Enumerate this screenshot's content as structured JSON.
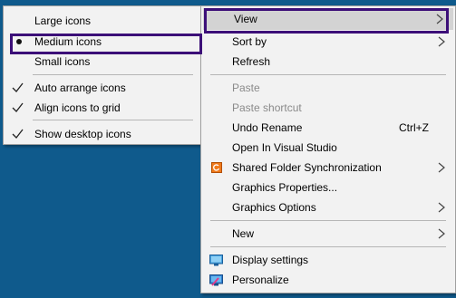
{
  "submenu": {
    "items": [
      {
        "label": "Large icons"
      },
      {
        "label": "Medium icons",
        "selected": true
      },
      {
        "label": "Small icons"
      },
      {
        "label": "Auto arrange icons",
        "checked": true
      },
      {
        "label": "Align icons to grid",
        "checked": true
      },
      {
        "label": "Show desktop icons",
        "checked": true
      }
    ]
  },
  "context_menu": {
    "items": [
      {
        "label": "View",
        "submenu": true,
        "highlighted": true
      },
      {
        "label": "Sort by",
        "submenu": true
      },
      {
        "label": "Refresh"
      },
      {
        "label": "Paste",
        "disabled": true
      },
      {
        "label": "Paste shortcut",
        "disabled": true
      },
      {
        "label": "Undo Rename",
        "shortcut": "Ctrl+Z"
      },
      {
        "label": "Open In Visual Studio"
      },
      {
        "label": "Shared Folder Synchronization",
        "submenu": true,
        "icon": "shared-folder-sync-icon"
      },
      {
        "label": "Graphics Properties..."
      },
      {
        "label": "Graphics Options",
        "submenu": true
      },
      {
        "label": "New",
        "submenu": true
      },
      {
        "label": "Display settings",
        "icon": "display-settings-icon"
      },
      {
        "label": "Personalize",
        "icon": "personalize-icon"
      }
    ]
  },
  "colors": {
    "desktop_background": "#0f5a8c",
    "menu_background": "#f2f2f2",
    "highlight_outline": "#3c0f78",
    "highlight_fill": "#d3d3d3",
    "disabled_text": "#8a8a8a"
  }
}
